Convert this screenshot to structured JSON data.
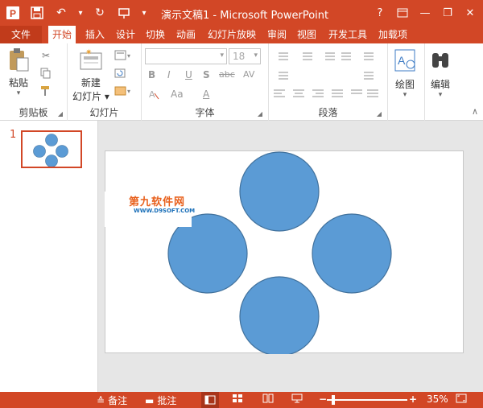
{
  "window": {
    "title": "演示文稿1 - Microsoft PowerPoint",
    "help_label": "?",
    "min_label": "—",
    "restore_label": "❐",
    "close_label": "✕"
  },
  "qat": {
    "undo_label": "↶",
    "redo_label": "↻",
    "dropdown_label": "▾"
  },
  "tabs": [
    "文件",
    "开始",
    "插入",
    "设计",
    "切换",
    "动画",
    "幻灯片放映",
    "审阅",
    "视图",
    "开发工具",
    "加载项"
  ],
  "ribbon": {
    "clipboard": {
      "paste_label": "粘贴",
      "group_label": "剪贴板"
    },
    "slides": {
      "new_slide_line1": "新建",
      "new_slide_line2": "幻灯片 ▾",
      "group_label": "幻灯片"
    },
    "font": {
      "font_name": "",
      "font_size": "18",
      "group_label": "字体",
      "bold": "B",
      "italic": "I",
      "underline": "U",
      "shadow": "S",
      "strike": "abc",
      "spacing": "AV",
      "case": "Aa",
      "color": "A"
    },
    "paragraph": {
      "group_label": "段落"
    },
    "drawing": {
      "label": "绘图"
    },
    "editing": {
      "label": "编辑"
    }
  },
  "thumbnails": [
    {
      "number": "1"
    }
  ],
  "watermark": {
    "line1": "第九软件网",
    "line2": "WWW.D9SOFT.COM"
  },
  "status": {
    "notes_label": "备注",
    "comments_label": "批注",
    "zoom_minus": "−",
    "zoom_plus": "+",
    "zoom_percent": "35%",
    "zoom_fraction": 0.35
  },
  "colors": {
    "accent": "#d24726",
    "shape_fill": "#5b9bd5",
    "shape_stroke": "#41719c"
  }
}
